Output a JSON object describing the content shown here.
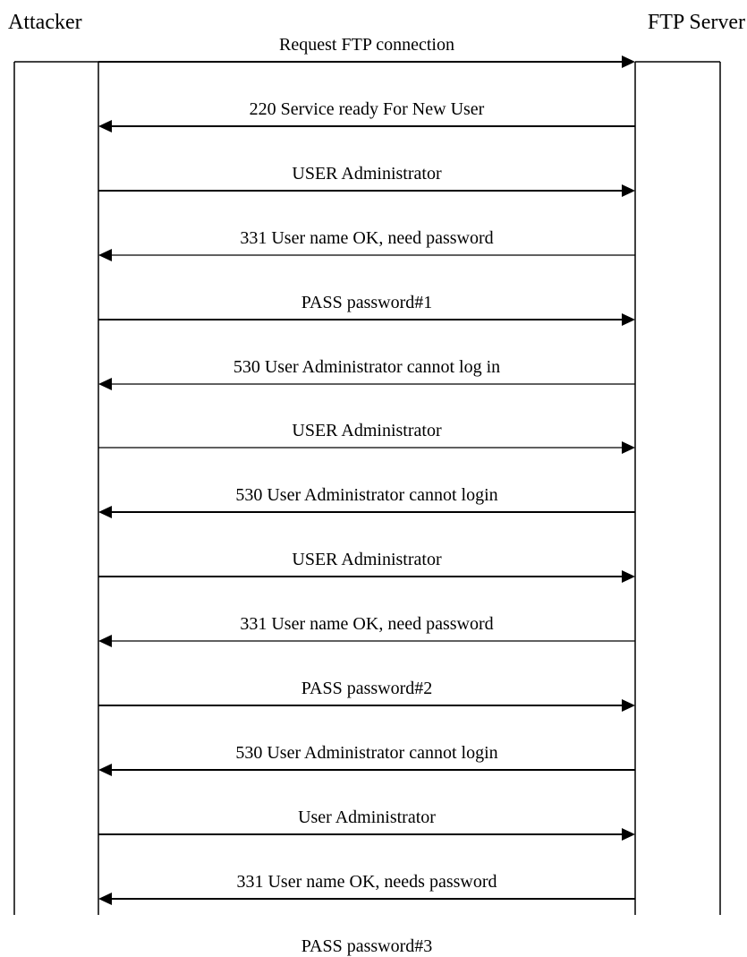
{
  "participants": {
    "attacker": "Attacker",
    "server": "FTP Server"
  },
  "messages": [
    {
      "text": "Request FTP connection",
      "direction": "right"
    },
    {
      "text": "220 Service ready For New User",
      "direction": "left"
    },
    {
      "text": "USER Administrator",
      "direction": "right"
    },
    {
      "text": "331 User name OK, need password",
      "direction": "left"
    },
    {
      "text": "PASS password#1",
      "direction": "right"
    },
    {
      "text": "530 User Administrator cannot log in",
      "direction": "left"
    },
    {
      "text": "USER Administrator",
      "direction": "right"
    },
    {
      "text": "530 User Administrator cannot login",
      "direction": "left"
    },
    {
      "text": "USER Administrator",
      "direction": "right"
    },
    {
      "text": "331 User name OK, need password",
      "direction": "left"
    },
    {
      "text": "PASS password#2",
      "direction": "right"
    },
    {
      "text": "530 User Administrator cannot login",
      "direction": "left"
    },
    {
      "text": "User Administrator",
      "direction": "right"
    },
    {
      "text": "331 User name OK, needs password",
      "direction": "left"
    },
    {
      "text": "PASS password#3",
      "direction": "right"
    }
  ]
}
